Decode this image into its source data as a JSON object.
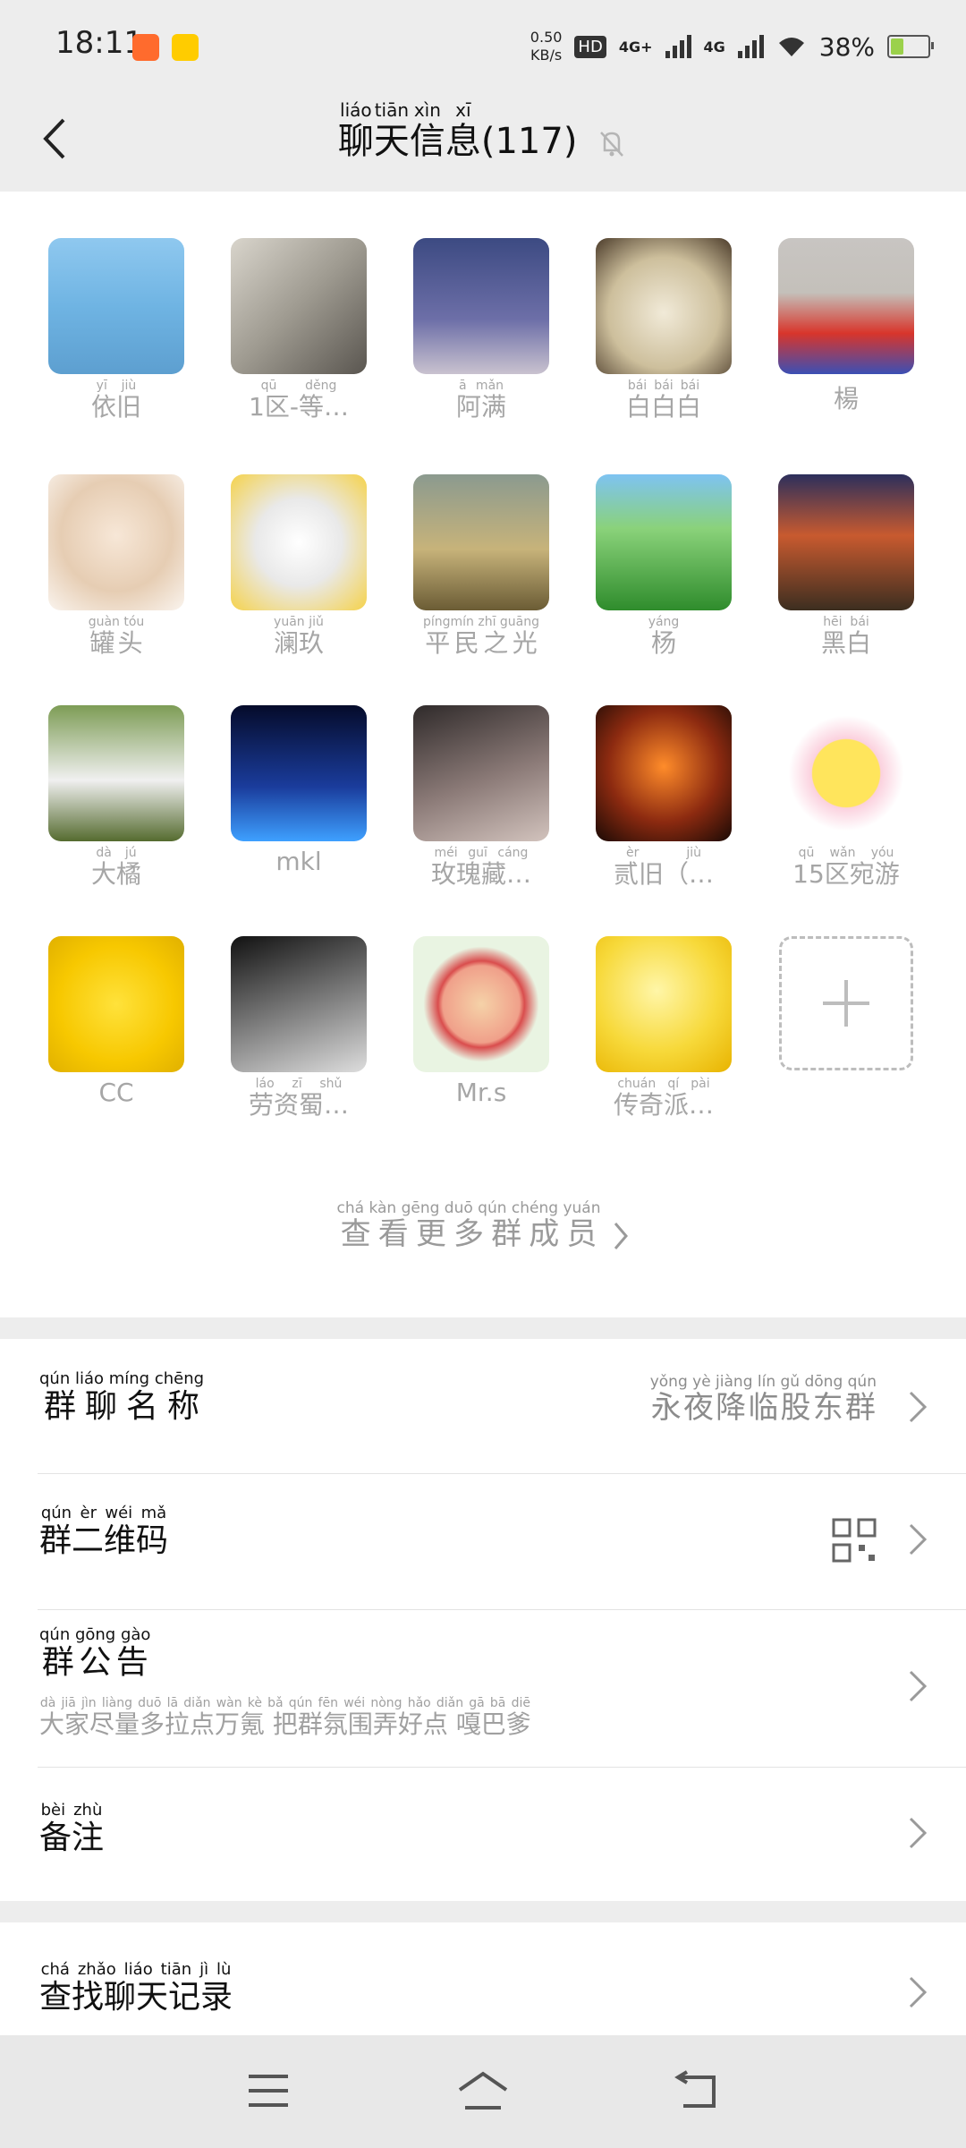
{
  "status": {
    "time": "18:11",
    "net_speed_value": "0.50",
    "net_speed_unit": "KB/s",
    "hd_label": "HD",
    "net1": "4G+",
    "net2": "4G",
    "battery_text": "38%",
    "battery_level": 0.38
  },
  "header": {
    "title": "聊天信息",
    "title_ruby": [
      "liáo",
      "tiān",
      "xìn",
      "xī"
    ],
    "title_chars": [
      "聊",
      "天",
      "信",
      "息"
    ],
    "count": "(117)"
  },
  "members": [
    {
      "name": "依旧",
      "ruby": "yī jiù",
      "avatar_icon": "beach-person-avatar"
    },
    {
      "name": "1区-等…",
      "ruby": "qū děng",
      "avatar_icon": "creation-painting-avatar"
    },
    {
      "name": "阿满",
      "ruby": "ā mǎn",
      "avatar_icon": "girl-avatar"
    },
    {
      "name": "白白白",
      "ruby": "bái bái bái",
      "avatar_icon": "cat-avatar"
    },
    {
      "name": "楊",
      "ruby": "",
      "avatar_icon": "ultraman-avatar"
    },
    {
      "name": "罐头",
      "ruby": "guàn tóu",
      "avatar_icon": "praying-child-avatar"
    },
    {
      "name": "澜玖",
      "ruby": "yuān jiǔ",
      "avatar_icon": "white-dragon-avatar"
    },
    {
      "name": "平民之光",
      "ruby": "píngmín zhī guāng",
      "avatar_icon": "eiffel-tower-avatar"
    },
    {
      "name": "杨",
      "ruby": "yáng",
      "avatar_icon": "grassland-avatar"
    },
    {
      "name": "黑白",
      "ruby": "hēi bái",
      "avatar_icon": "sunset-rabbit-avatar"
    },
    {
      "name": "大橘",
      "ruby": "dà jú",
      "avatar_icon": "dog-grass-avatar"
    },
    {
      "name": "mkl",
      "ruby": "",
      "avatar_icon": "fountain-night-avatar"
    },
    {
      "name": "玫瑰藏…",
      "ruby": "méi guī cáng",
      "avatar_icon": "anime-man-avatar"
    },
    {
      "name": "贰旧（…",
      "ruby": "èr jiù",
      "avatar_icon": "warrior-fire-avatar"
    },
    {
      "name": "15区宛游",
      "ruby": "qū wǎn yóu",
      "avatar_icon": "fries-avatar"
    },
    {
      "name": "CC",
      "ruby": "",
      "avatar_icon": "pikachu-avatar"
    },
    {
      "name": "劳资蜀…",
      "ruby": "láo zī shǔ",
      "avatar_icon": "child-cat-avatar"
    },
    {
      "name": "Mr.s",
      "ruby": "",
      "avatar_icon": "bear-mirror-avatar"
    },
    {
      "name": "传奇派…",
      "ruby": "chuán qí pài",
      "avatar_icon": "smiley-face-avatar"
    }
  ],
  "view_more": {
    "label": "查看更多群成员",
    "ruby": "chá kàn gēng duō qún chéng yuán"
  },
  "settings": {
    "group_name": {
      "label": "群聊名称",
      "ruby": "qún liáo míng chēng",
      "value": "永夜降临股东群",
      "value_ruby": "yǒng yè jiàng lín gǔ dōng qún"
    },
    "qr_code": {
      "label": "群二维码",
      "ruby": "qún èr wéi mǎ"
    },
    "announcement": {
      "label": "群公告",
      "ruby": "qún gōng gào",
      "text": "大家尽量多拉点万氪 把群氛围弄好点 嘎巴爹",
      "text_ruby": "dà jiā jìn liàng duō lā diǎn wàn kè  bǎ qún fēn wéi nòng hǎo diǎn  gā bā diē"
    },
    "remark": {
      "label": "备注",
      "ruby": "bèi zhù"
    }
  },
  "search_history": {
    "label": "查找聊天记录",
    "ruby": "chá zhǎo liáo tiān jì lù"
  }
}
